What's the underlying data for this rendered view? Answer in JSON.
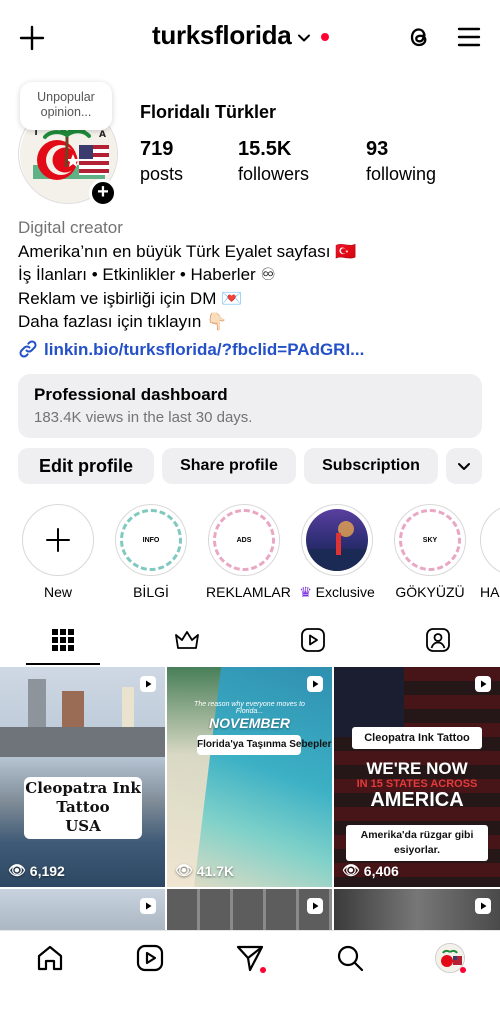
{
  "header": {
    "username": "turksflorida",
    "icons": [
      "plus-icon",
      "chevron-down-icon",
      "threads-icon",
      "menu-icon"
    ],
    "notification_color": "#ff0033"
  },
  "profile": {
    "note": "Unpopular opinion...",
    "display_name": "Floridalı Türkler",
    "stats": [
      {
        "value": "719",
        "label": "posts"
      },
      {
        "value": "15.5K",
        "label": "followers"
      },
      {
        "value": "93",
        "label": "following"
      }
    ]
  },
  "bio": {
    "category": "Digital creator",
    "lines": [
      "Amerika’nın en büyük Türk Eyalet sayfası 🇹🇷",
      "İş İlanları • Etkinlikler • Haberler ♾",
      "Reklam ve işbirliği için DM 💌",
      "Daha fazlası için tıklayın 👇🏻"
    ],
    "link": "linkin.bio/turksflorida/?fbclid=PAdGRI..."
  },
  "dashboard": {
    "title": "Professional dashboard",
    "subtitle": "183.4K views in the last 30 days."
  },
  "actions": {
    "edit": "Edit profile",
    "share": "Share profile",
    "subscription": "Subscription"
  },
  "highlights": [
    {
      "label": "New",
      "cover": ""
    },
    {
      "label": "BİLGİ",
      "cover": "INFO"
    },
    {
      "label": "REKLAMLAR",
      "cover": "ADS"
    },
    {
      "label": "Exclusive",
      "cover": ""
    },
    {
      "label": "GÖKYÜZÜ",
      "cover": "SKY"
    },
    {
      "label": "HA",
      "cover": ""
    }
  ],
  "tabs": [
    "grid-icon",
    "crown-icon",
    "reels-icon",
    "tagged-icon"
  ],
  "posts": [
    {
      "overlay": [
        "Cleopatra Ink",
        "Tattoo",
        "USA"
      ],
      "views": "6,192"
    },
    {
      "small": "The reason why everyone moves to Florida...",
      "month": "NOVEMBER",
      "caption": "Florida'ya Taşınma Sebepleri",
      "views": "41.7K"
    },
    {
      "brand": "Cleopatra Ink Tattoo",
      "headline1": "WE'RE NOW",
      "headline2": "IN 15 STATES ACROSS",
      "headline3": "AMERICA",
      "caption": "Amerika'da rüzgar gibi esiyorlar.",
      "views": "6,406"
    }
  ],
  "bottom_nav": [
    "home-icon",
    "reels-icon",
    "messages-icon",
    "search-icon",
    "profile-avatar"
  ]
}
